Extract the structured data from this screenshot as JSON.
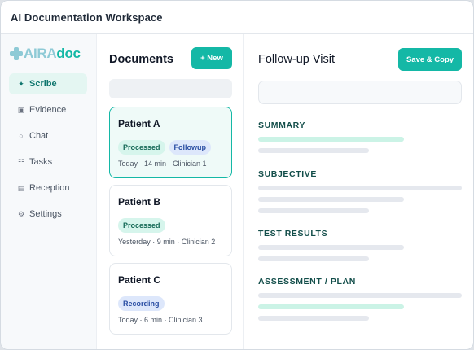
{
  "window": {
    "title": "AI Documentation Workspace"
  },
  "brand": {
    "part_a": "AIRA",
    "part_b": "doc"
  },
  "sidebar": {
    "items": [
      {
        "icon": "✦",
        "label": "Scribe",
        "active": true
      },
      {
        "icon": "▣",
        "label": "Evidence"
      },
      {
        "icon": "○",
        "label": "Chat"
      },
      {
        "icon": "☷",
        "label": "Tasks"
      },
      {
        "icon": "▤",
        "label": "Reception"
      },
      {
        "icon": "⚙",
        "label": "Settings"
      }
    ]
  },
  "documents": {
    "title": "Documents",
    "new_button": "+ New",
    "items": [
      {
        "name": "Patient A",
        "tags": [
          "Processed",
          "Followup"
        ],
        "meta": "Today · 14 min · Clinician 1",
        "selected": true
      },
      {
        "name": "Patient B",
        "tags": [
          "Processed"
        ],
        "meta": "Yesterday · 9 min · Clinician 2"
      },
      {
        "name": "Patient C",
        "tags": [
          "Recording"
        ],
        "meta": "Today · 6 min · Clinician 3"
      }
    ]
  },
  "detail": {
    "title": "Follow-up Visit",
    "save_button": "Save & Copy",
    "sections": [
      {
        "heading": "SUMMARY"
      },
      {
        "heading": "SUBJECTIVE"
      },
      {
        "heading": "TEST RESULTS"
      },
      {
        "heading": "ASSESSMENT / PLAN"
      }
    ]
  },
  "colors": {
    "accent": "#14b8a6",
    "accent_dark": "#0f766e",
    "tag_green_bg": "#d6f5ec",
    "tag_blue_bg": "#dde7fb"
  }
}
